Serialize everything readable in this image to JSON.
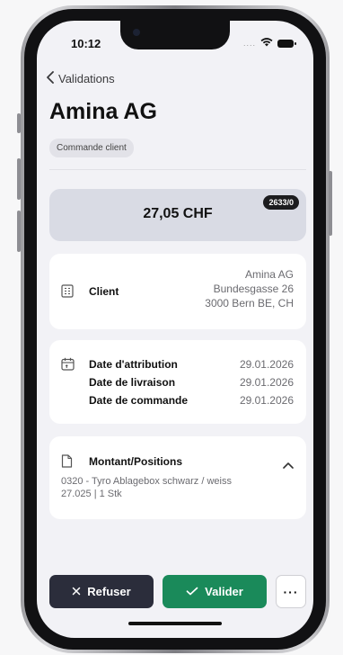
{
  "status_bar": {
    "time": "10:12",
    "signal_dots": "....",
    "wifi_icon": "wifi-icon",
    "battery_icon": "battery-icon"
  },
  "nav": {
    "back_label": "Validations",
    "back_icon": "chevron-left-icon"
  },
  "header": {
    "title": "Amina AG",
    "type_badge": "Commande client"
  },
  "amount": {
    "value": "27,05 CHF",
    "reference": "2633/0"
  },
  "client": {
    "icon": "building-icon",
    "label": "Client",
    "address_lines": [
      "Amina AG",
      "Bundesgasse 26",
      "3000 Bern BE, CH"
    ]
  },
  "dates": {
    "icon": "calendar-icon",
    "rows": [
      {
        "label": "Date d'attribution",
        "value": "29.01.2026"
      },
      {
        "label": "Date de livraison",
        "value": "29.01.2026"
      },
      {
        "label": "Date de commande",
        "value": "29.01.2026"
      }
    ]
  },
  "positions": {
    "icon": "document-icon",
    "label": "Montant/Positions",
    "toggle_icon": "chevron-up-icon",
    "lines": [
      "0320 - Tyro Ablagebox schwarz / weiss",
      "27.025 | 1 Stk"
    ]
  },
  "actions": {
    "refuse_label": "Refuser",
    "refuse_icon": "x-icon",
    "validate_label": "Valider",
    "validate_icon": "check-icon",
    "more_label": "···",
    "colors": {
      "refuse_bg": "#2b2d3b",
      "validate_bg": "#1a8a5a"
    }
  }
}
